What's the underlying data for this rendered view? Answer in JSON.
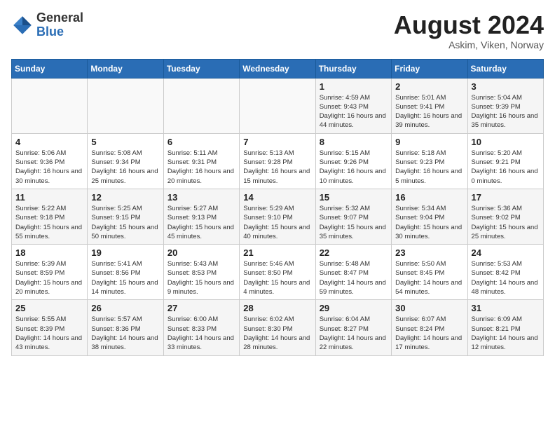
{
  "header": {
    "logo_general": "General",
    "logo_blue": "Blue",
    "month_year": "August 2024",
    "location": "Askim, Viken, Norway"
  },
  "days_of_week": [
    "Sunday",
    "Monday",
    "Tuesday",
    "Wednesday",
    "Thursday",
    "Friday",
    "Saturday"
  ],
  "weeks": [
    [
      {
        "day": "",
        "info": ""
      },
      {
        "day": "",
        "info": ""
      },
      {
        "day": "",
        "info": ""
      },
      {
        "day": "",
        "info": ""
      },
      {
        "day": "1",
        "info": "Sunrise: 4:59 AM\nSunset: 9:43 PM\nDaylight: 16 hours and 44 minutes."
      },
      {
        "day": "2",
        "info": "Sunrise: 5:01 AM\nSunset: 9:41 PM\nDaylight: 16 hours and 39 minutes."
      },
      {
        "day": "3",
        "info": "Sunrise: 5:04 AM\nSunset: 9:39 PM\nDaylight: 16 hours and 35 minutes."
      }
    ],
    [
      {
        "day": "4",
        "info": "Sunrise: 5:06 AM\nSunset: 9:36 PM\nDaylight: 16 hours and 30 minutes."
      },
      {
        "day": "5",
        "info": "Sunrise: 5:08 AM\nSunset: 9:34 PM\nDaylight: 16 hours and 25 minutes."
      },
      {
        "day": "6",
        "info": "Sunrise: 5:11 AM\nSunset: 9:31 PM\nDaylight: 16 hours and 20 minutes."
      },
      {
        "day": "7",
        "info": "Sunrise: 5:13 AM\nSunset: 9:28 PM\nDaylight: 16 hours and 15 minutes."
      },
      {
        "day": "8",
        "info": "Sunrise: 5:15 AM\nSunset: 9:26 PM\nDaylight: 16 hours and 10 minutes."
      },
      {
        "day": "9",
        "info": "Sunrise: 5:18 AM\nSunset: 9:23 PM\nDaylight: 16 hours and 5 minutes."
      },
      {
        "day": "10",
        "info": "Sunrise: 5:20 AM\nSunset: 9:21 PM\nDaylight: 16 hours and 0 minutes."
      }
    ],
    [
      {
        "day": "11",
        "info": "Sunrise: 5:22 AM\nSunset: 9:18 PM\nDaylight: 15 hours and 55 minutes."
      },
      {
        "day": "12",
        "info": "Sunrise: 5:25 AM\nSunset: 9:15 PM\nDaylight: 15 hours and 50 minutes."
      },
      {
        "day": "13",
        "info": "Sunrise: 5:27 AM\nSunset: 9:13 PM\nDaylight: 15 hours and 45 minutes."
      },
      {
        "day": "14",
        "info": "Sunrise: 5:29 AM\nSunset: 9:10 PM\nDaylight: 15 hours and 40 minutes."
      },
      {
        "day": "15",
        "info": "Sunrise: 5:32 AM\nSunset: 9:07 PM\nDaylight: 15 hours and 35 minutes."
      },
      {
        "day": "16",
        "info": "Sunrise: 5:34 AM\nSunset: 9:04 PM\nDaylight: 15 hours and 30 minutes."
      },
      {
        "day": "17",
        "info": "Sunrise: 5:36 AM\nSunset: 9:02 PM\nDaylight: 15 hours and 25 minutes."
      }
    ],
    [
      {
        "day": "18",
        "info": "Sunrise: 5:39 AM\nSunset: 8:59 PM\nDaylight: 15 hours and 20 minutes."
      },
      {
        "day": "19",
        "info": "Sunrise: 5:41 AM\nSunset: 8:56 PM\nDaylight: 15 hours and 14 minutes."
      },
      {
        "day": "20",
        "info": "Sunrise: 5:43 AM\nSunset: 8:53 PM\nDaylight: 15 hours and 9 minutes."
      },
      {
        "day": "21",
        "info": "Sunrise: 5:46 AM\nSunset: 8:50 PM\nDaylight: 15 hours and 4 minutes."
      },
      {
        "day": "22",
        "info": "Sunrise: 5:48 AM\nSunset: 8:47 PM\nDaylight: 14 hours and 59 minutes."
      },
      {
        "day": "23",
        "info": "Sunrise: 5:50 AM\nSunset: 8:45 PM\nDaylight: 14 hours and 54 minutes."
      },
      {
        "day": "24",
        "info": "Sunrise: 5:53 AM\nSunset: 8:42 PM\nDaylight: 14 hours and 48 minutes."
      }
    ],
    [
      {
        "day": "25",
        "info": "Sunrise: 5:55 AM\nSunset: 8:39 PM\nDaylight: 14 hours and 43 minutes."
      },
      {
        "day": "26",
        "info": "Sunrise: 5:57 AM\nSunset: 8:36 PM\nDaylight: 14 hours and 38 minutes."
      },
      {
        "day": "27",
        "info": "Sunrise: 6:00 AM\nSunset: 8:33 PM\nDaylight: 14 hours and 33 minutes."
      },
      {
        "day": "28",
        "info": "Sunrise: 6:02 AM\nSunset: 8:30 PM\nDaylight: 14 hours and 28 minutes."
      },
      {
        "day": "29",
        "info": "Sunrise: 6:04 AM\nSunset: 8:27 PM\nDaylight: 14 hours and 22 minutes."
      },
      {
        "day": "30",
        "info": "Sunrise: 6:07 AM\nSunset: 8:24 PM\nDaylight: 14 hours and 17 minutes."
      },
      {
        "day": "31",
        "info": "Sunrise: 6:09 AM\nSunset: 8:21 PM\nDaylight: 14 hours and 12 minutes."
      }
    ]
  ]
}
